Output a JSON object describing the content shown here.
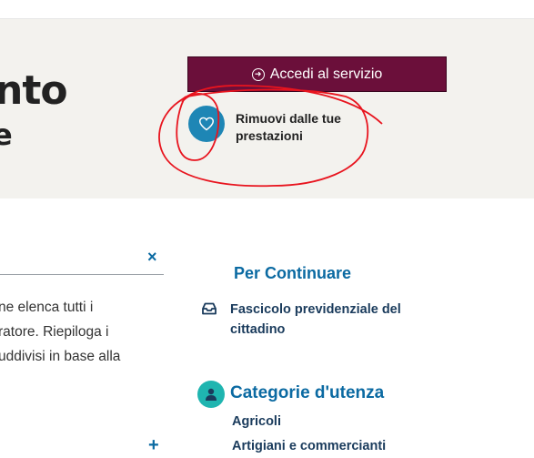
{
  "hero": {
    "title_fragment": "nto",
    "subtitle_fragment": "e",
    "access_button": "Accedi al servizio",
    "access_icon": "arrow-circle-right-icon",
    "favorite_label": "Rimuovi dalle tue prestazioni",
    "favorite_icon": "heart-icon"
  },
  "panel": {
    "close_symbol": "×",
    "description_lines": [
      "ne elenca tutti i",
      "ratore. Riepiloga i",
      "uddivisi in base alla"
    ],
    "expand_symbol": "+"
  },
  "continue": {
    "heading": "Per Continuare",
    "link_icon": "inbox-icon",
    "link": "Fascicolo previdenziale del cittadino"
  },
  "categories": {
    "icon": "user-icon",
    "heading": "Categorie d'utenza",
    "items": [
      "Agricoli",
      "Artigiani e commercianti"
    ]
  },
  "colors": {
    "accent_primary": "#6b0f3a",
    "link_blue": "#0b6aa2",
    "teal": "#1fb5b0",
    "annotation_red": "#e8141e"
  }
}
